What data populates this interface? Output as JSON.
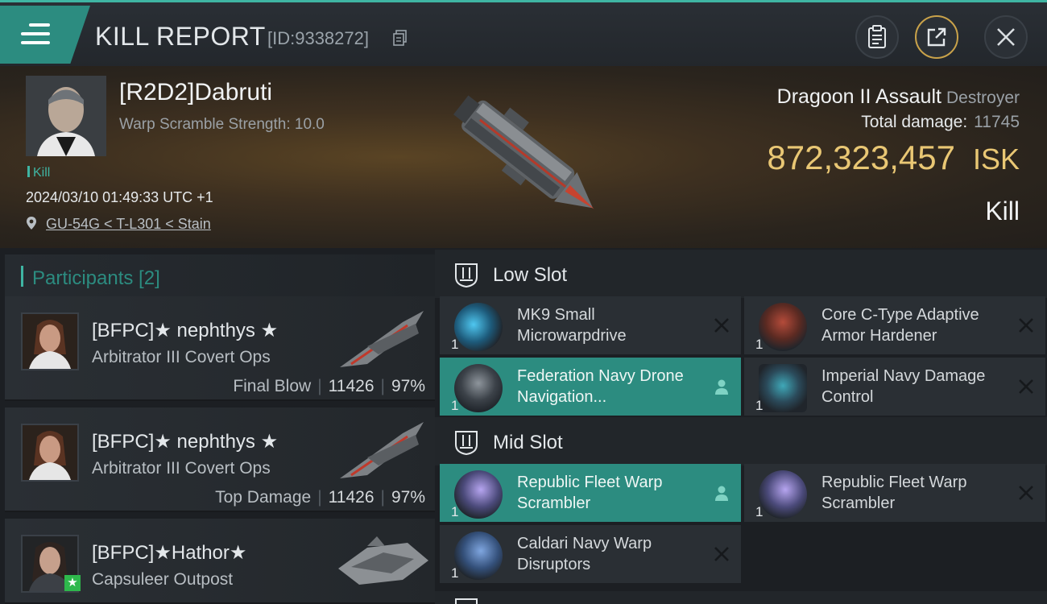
{
  "header": {
    "title": "KILL REPORT",
    "report_id": "[ID:9338272]"
  },
  "victim": {
    "name": "[R2D2]Dabruti",
    "warp_scramble": "Warp Scramble Strength: 10.0",
    "kill_tag": "Kill",
    "date": "2024/03/10 01:49:33 UTC +1",
    "location": "GU-54G < T-L301 < Stain",
    "ship_name": "Dragoon II Assault",
    "ship_class": "Destroyer",
    "total_damage_label": "Total damage:",
    "total_damage": "11745",
    "isk_value": "872,323,457",
    "isk_currency": "ISK",
    "result": "Kill"
  },
  "participants": {
    "title": "Participants [2]",
    "items": [
      {
        "name": "[BFPC]★ nephthys ★",
        "ship": "Arbitrator III Covert Ops",
        "role": "Final Blow",
        "damage": "11426",
        "percent": "97%"
      },
      {
        "name": "[BFPC]★ nephthys ★",
        "ship": "Arbitrator III Covert Ops",
        "role": "Top Damage",
        "damage": "11426",
        "percent": "97%"
      },
      {
        "name": "[BFPC]★Hathor★",
        "ship": "Capsuleer Outpost",
        "role": "",
        "damage": "",
        "percent": ""
      }
    ]
  },
  "fitting": {
    "low_slot": {
      "title": "Low Slot",
      "modules": [
        {
          "name": "MK9 Small Microwarpdrive",
          "qty": "1"
        },
        {
          "name": "Core C-Type Adaptive Armor Hardener",
          "qty": "1"
        },
        {
          "name": "Federation Navy Drone Navigation...",
          "qty": "1"
        },
        {
          "name": "Imperial Navy Damage Control",
          "qty": "1"
        }
      ]
    },
    "mid_slot": {
      "title": "Mid Slot",
      "modules": [
        {
          "name": "Republic Fleet Warp Scrambler",
          "qty": "1"
        },
        {
          "name": "Republic Fleet Warp Scrambler",
          "qty": "1"
        },
        {
          "name": "Caldari Navy Warp Disruptors",
          "qty": "1"
        }
      ]
    }
  },
  "icons": {
    "menu": "menu-icon",
    "copy": "copy-icon",
    "clipboard": "clipboard-icon",
    "share": "share-icon",
    "close": "close-icon",
    "location": "location-pin-icon"
  },
  "colors": {
    "accent": "#3fb5a3",
    "active_row": "#2c8c80",
    "isk": "#e9c774"
  }
}
